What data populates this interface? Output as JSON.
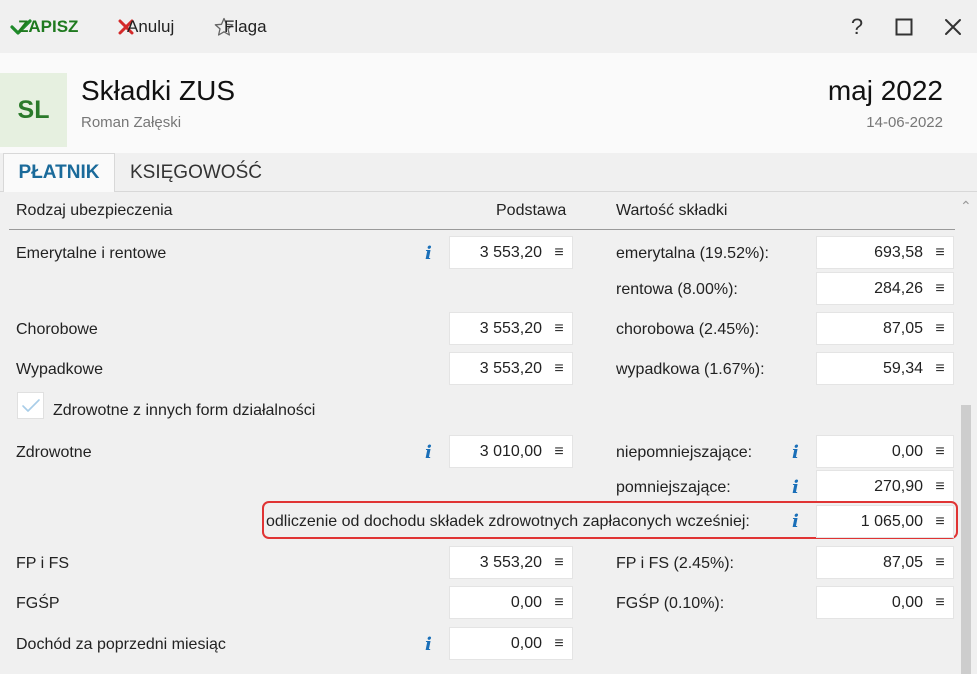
{
  "toolbar": {
    "save_label": "ZAPISZ",
    "cancel_label": "Anuluj",
    "flag_label": "Flaga",
    "help_label": "?"
  },
  "header": {
    "avatar": "SL",
    "title": "Składki ZUS",
    "subtitle": "Roman Załęski",
    "period": "maj 2022",
    "date": "14-06-2022"
  },
  "tabs": [
    {
      "label": "PŁATNIK",
      "active": true
    },
    {
      "label": "KSIĘGOWOŚĆ",
      "active": false
    }
  ],
  "columns": {
    "type": "Rodzaj ubezpieczenia",
    "base": "Podstawa",
    "value": "Wartość składki"
  },
  "rows": {
    "emerytalne": {
      "label": "Emerytalne i rentowe",
      "base": "3 553,20"
    },
    "emerytalna": {
      "label": "emerytalna (19.52%):",
      "value": "693,58"
    },
    "rentowa": {
      "label": "rentowa (8.00%):",
      "value": "284,26"
    },
    "chorobowe": {
      "label": "Chorobowe",
      "base": "3 553,20"
    },
    "chorobowa": {
      "label": "chorobowa (2.45%):",
      "value": "87,05"
    },
    "wypadkowe": {
      "label": "Wypadkowe",
      "base": "3 553,20"
    },
    "wypadkowa": {
      "label": "wypadkowa (1.67%):",
      "value": "59,34"
    },
    "zdrowotne_inne": {
      "label": "Zdrowotne z innych form działalności",
      "checked": true
    },
    "zdrowotne": {
      "label": "Zdrowotne",
      "base": "3 010,00"
    },
    "niepomniejszajace": {
      "label": "niepomniejszające:",
      "value": "0,00"
    },
    "pomniejszajace": {
      "label": "pomniejszające:",
      "value": "270,90"
    },
    "odliczenie": {
      "label": "odliczenie od dochodu składek zdrowotnych zapłaconych wcześniej:",
      "value": "1 065,00"
    },
    "fpfs": {
      "label": "FP i FS",
      "base": "3 553,20"
    },
    "fpfs_val": {
      "label": "FP i FS (2.45%):",
      "value": "87,05"
    },
    "fgsp": {
      "label": "FGŚP",
      "base": "0,00"
    },
    "fgsp_val": {
      "label": "FGŚP (0.10%):",
      "value": "0,00"
    },
    "dochod": {
      "label": "Dochód za poprzedni miesiąc",
      "base": "0,00"
    }
  },
  "icons": {
    "info_glyph": "i",
    "menu_glyph": "≡",
    "scroll_up": "⌃"
  },
  "colors": {
    "accent": "#1a6a9a",
    "save": "#1f7a1f",
    "cancel": "#d42a2a",
    "info": "#1a6fb8",
    "highlight": "#e03434"
  }
}
